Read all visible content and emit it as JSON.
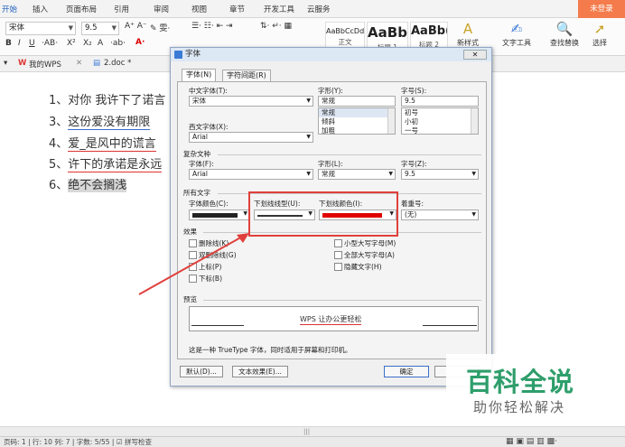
{
  "ribbon_tabs": [
    "开始",
    "插入",
    "页面布局",
    "引用",
    "审阅",
    "视图",
    "章节",
    "开发工具",
    "云服务"
  ],
  "login_label": "未登录",
  "toolbar": {
    "font_name": "宋体",
    "font_size": "9.5",
    "style_samples": [
      {
        "sample": "AaBbCcDd",
        "caption": "正文"
      },
      {
        "sample": "AaBb",
        "caption": "标题 1"
      },
      {
        "sample": "AaBb(",
        "caption": "标题 2"
      }
    ],
    "new_style_label": "新样式",
    "text_tools_label": "文字工具",
    "find_replace_label": "查找替换",
    "select_label": "选择"
  },
  "doc_tabs": {
    "wps_label": "我的WPS",
    "doc_label": "2.doc *"
  },
  "document": {
    "lines": [
      {
        "num": "1、",
        "text": "对你  我许下了诺言"
      },
      {
        "num": "3、",
        "text": "这份爱没有期限"
      },
      {
        "num": "4、",
        "text": "爱_是风中的谎言"
      },
      {
        "num": "5、",
        "text": "许下的承诺是永远"
      },
      {
        "num": "6、",
        "text": "绝不会搁浅"
      }
    ]
  },
  "dialog": {
    "title": "字体",
    "close_label": "✕",
    "tabs": [
      "字体(N)",
      "字符间距(R)"
    ],
    "chinese_font_label": "中文字体(T):",
    "chinese_font_value": "宋体",
    "style_label": "字形(Y):",
    "style_value": "常规",
    "style_options": [
      "常规",
      "倾斜",
      "加粗"
    ],
    "size_label": "字号(S):",
    "size_value": "9.5",
    "size_options": [
      "初号",
      "小初",
      "一号"
    ],
    "western_font_label": "西文字体(X):",
    "western_font_value": "Arial",
    "complex_section": "复杂文种",
    "complex_font_label": "字体(F):",
    "complex_font_value": "Arial",
    "complex_style_label": "字形(L):",
    "complex_style_value": "常规",
    "complex_size_label": "字号(Z):",
    "complex_size_value": "9.5",
    "all_text_section": "所有文字",
    "font_color_label": "字体颜色(C):",
    "underline_type_label": "下划线线型(U):",
    "underline_color_label": "下划线颜色(I):",
    "emphasis_label": "着重号:",
    "emphasis_value": "(无)",
    "font_color": "#222222",
    "underline_color": "#e00000",
    "effects_section": "效果",
    "effects_left": [
      "删除线(K)",
      "双删除线(G)",
      "上标(P)",
      "下标(B)"
    ],
    "effects_right": [
      "小型大写字母(M)",
      "全部大写字母(A)",
      "隐藏文字(H)"
    ],
    "preview_section": "预览",
    "preview_text": "WPS 让办公更轻松",
    "truetype_note": "这是一种 TrueType 字体，同时适用于屏幕和打印机。",
    "default_button": "默认(D)...",
    "text_effect_button": "文本效果(E)...",
    "ok_button": "确定"
  },
  "watermark": {
    "title": "百科全说",
    "subtitle": "助你轻松解决"
  },
  "status_bar": {
    "position": "页码: 1  |  行: 10  列: 7  |  字数: 5/55  |  ☑ 拼写检查"
  },
  "colors": {
    "accent": "#3a7bd5",
    "annotation_red": "#e0403b",
    "watermark_green": "#2e9e6b"
  }
}
